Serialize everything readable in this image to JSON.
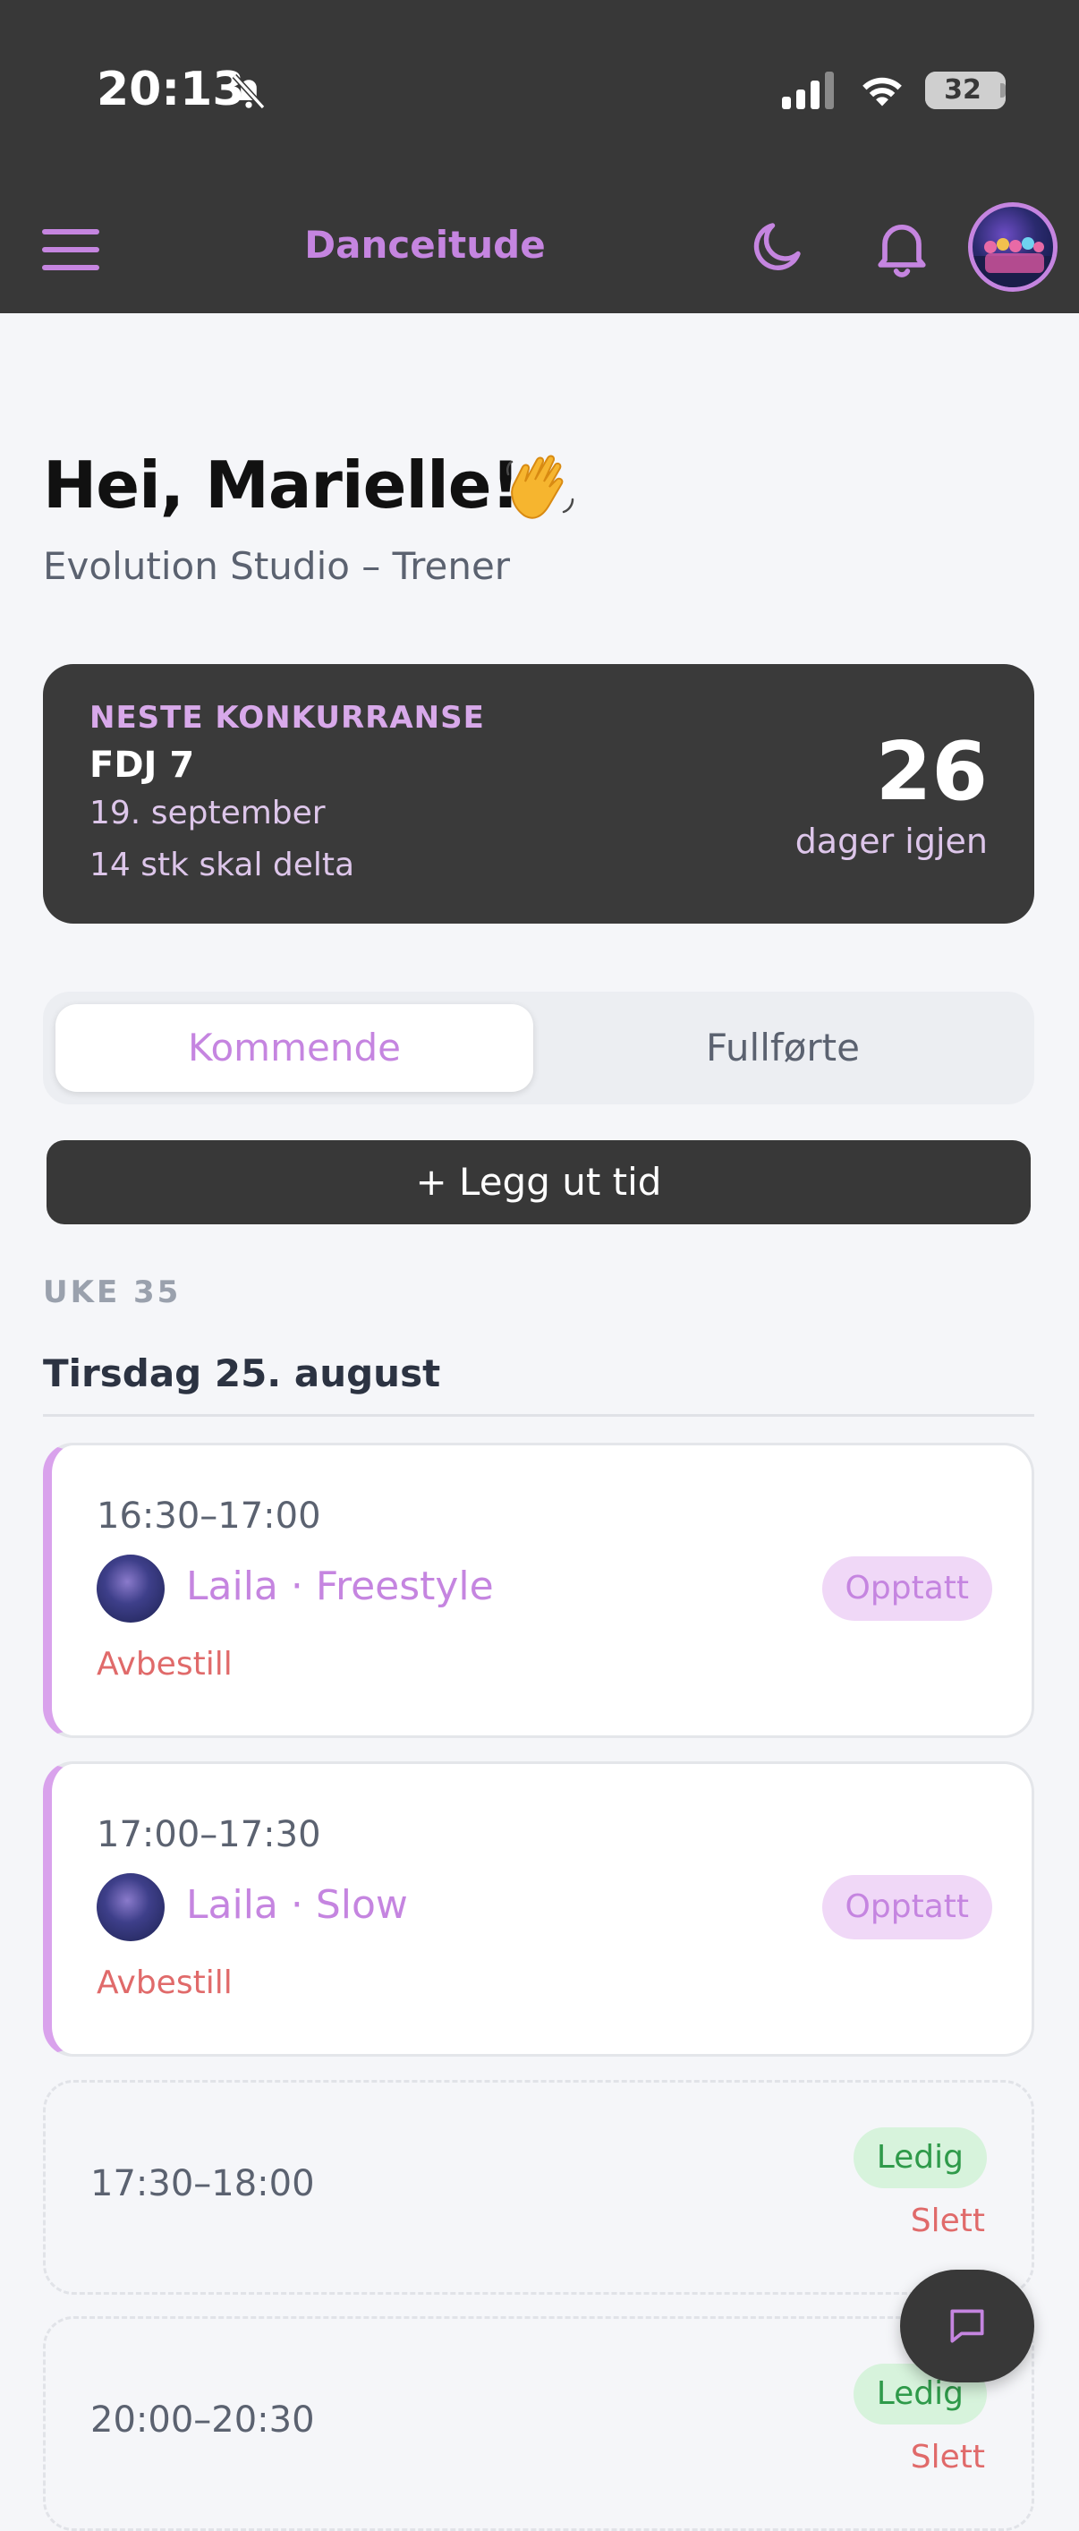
{
  "status_bar": {
    "time": "20:13",
    "battery": "32",
    "icons": [
      "bell-slash-icon",
      "signal-icon",
      "wifi-icon",
      "battery-icon"
    ]
  },
  "app_bar": {
    "title": "Danceitude",
    "icons": [
      "menu-icon",
      "moon-icon",
      "bell-icon",
      "profile-avatar"
    ]
  },
  "greeting": {
    "title": "Hei, Marielle!",
    "emoji": "👋",
    "subtitle": "Evolution Studio – Trener"
  },
  "competition": {
    "label": "NESTE KONKURRANSE",
    "name": "FDJ 7",
    "date": "19. september",
    "participants": "14 stk skal delta",
    "days": "26",
    "days_label": "dager igjen"
  },
  "tabs": {
    "active": "Kommende",
    "inactive": "Fullførte"
  },
  "add_button": "+ Legg ut tid",
  "week_label": "UKE 35",
  "day_heading": "Tirsdag 25. august",
  "slots": [
    {
      "time": "16:30–17:00",
      "who": "Laila · Freestyle",
      "status": "Opptatt",
      "action": "Avbestill"
    },
    {
      "time": "17:00–17:30",
      "who": "Laila · Slow",
      "status": "Opptatt",
      "action": "Avbestill"
    },
    {
      "time": "17:30–18:00",
      "status": "Ledig",
      "action": "Slett"
    },
    {
      "time": "20:00–20:30",
      "status": "Ledig",
      "action": "Slett"
    }
  ],
  "colors": {
    "accent": "#c585e0",
    "dark": "#383838",
    "danger": "#e06a6a",
    "success": "#2f9a4a"
  }
}
